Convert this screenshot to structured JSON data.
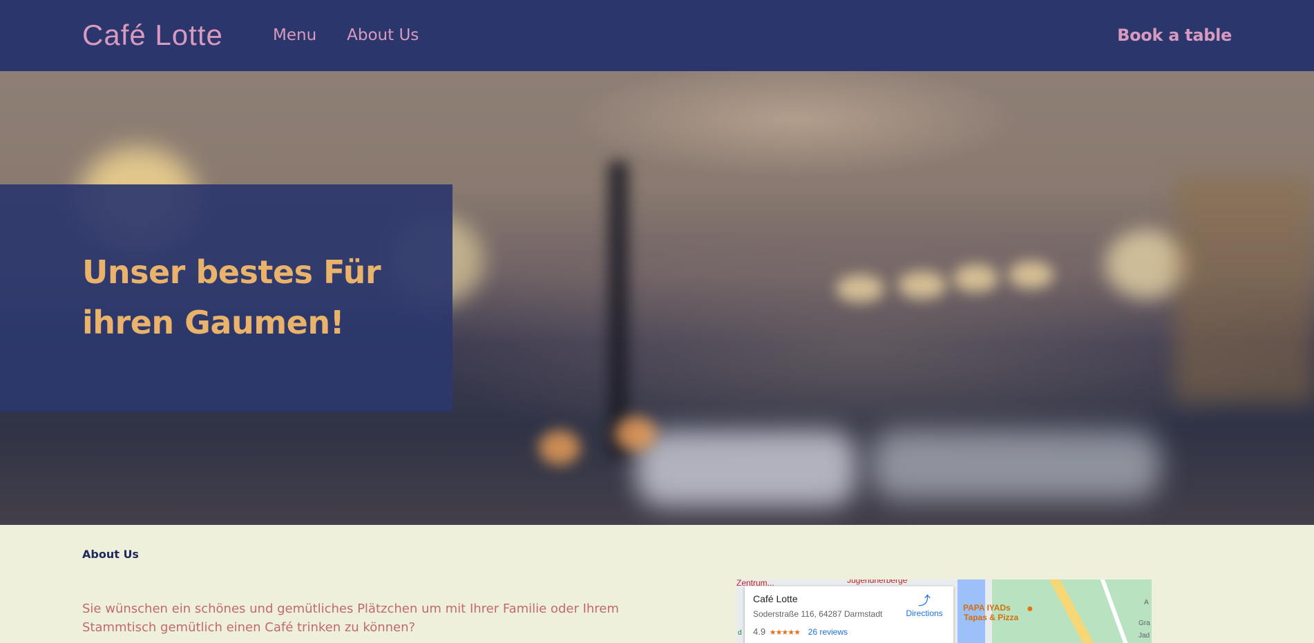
{
  "header": {
    "logo": "Café Lotte",
    "nav": [
      {
        "label": "Menu"
      },
      {
        "label": "About Us"
      }
    ],
    "cta": "Book a table"
  },
  "hero": {
    "title": "Unser bestes Für ihren Gaumen!"
  },
  "about": {
    "label": "About Us",
    "text": "Sie wünschen ein schönes und gemütliches Plätzchen um mit Ihrer Familie oder Ihrem Stammtisch gemütlich einen Café trinken zu können?"
  },
  "map": {
    "place_name": "Café Lotte",
    "address": "Soderstraße 116, 64287 Darmstadt",
    "rating": "4.9",
    "stars": "★★★★★",
    "reviews": "26 reviews",
    "directions_label": "Directions",
    "labels": [
      "Zentrum...",
      "Jugendherberge",
      "PAPA IYADs",
      "Tapas & Pizza",
      "A",
      "Gra",
      "Jad",
      "d"
    ]
  },
  "colors": {
    "header_bg": "#2b376c",
    "accent_pink": "#d99abf",
    "hero_title": "#eab36b",
    "about_bg": "#eef0dc",
    "about_text": "#c06a6a"
  }
}
